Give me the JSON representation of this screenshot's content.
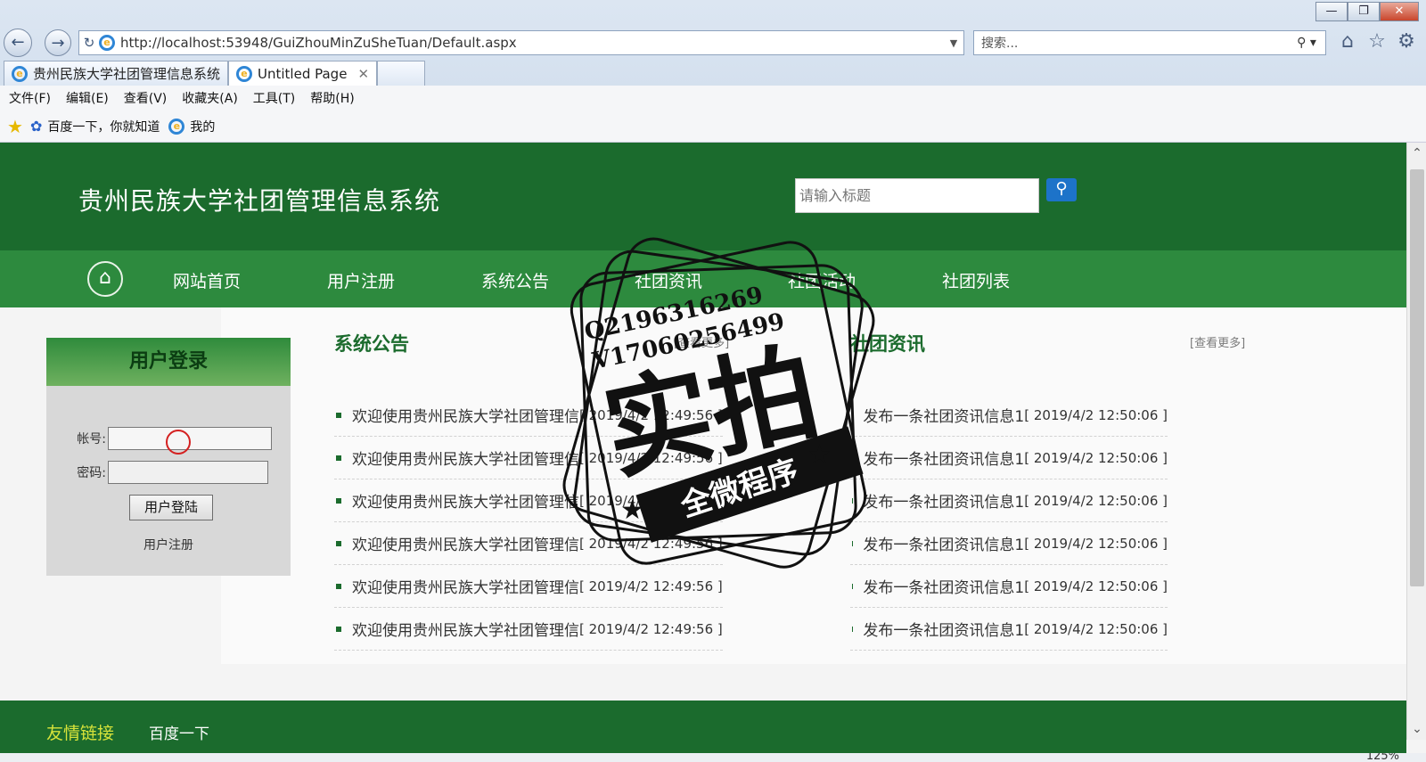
{
  "browser": {
    "url": "http://localhost:53948/GuiZhouMinZuSheTuan/Default.aspx",
    "search_placeholder": "搜索...",
    "tabs": [
      {
        "label": "贵州民族大学社团管理信息系统"
      },
      {
        "label": "Untitled Page"
      }
    ],
    "menu": [
      "文件(F)",
      "编辑(E)",
      "查看(V)",
      "收藏夹(A)",
      "工具(T)",
      "帮助(H)"
    ],
    "favorites": [
      "百度一下，你就知道",
      "我的"
    ],
    "zoom": "125%"
  },
  "site": {
    "title": "贵州民族大学社团管理信息系统",
    "search_placeholder": "请输入标题",
    "nav": [
      "网站首页",
      "用户注册",
      "系统公告",
      "社团资讯",
      "社团活动",
      "社团列表"
    ],
    "login": {
      "title": "用户登录",
      "account_label": "帐号:",
      "password_label": "密码:",
      "login_button": "用户登陆",
      "register_link": "用户注册"
    },
    "announcements": {
      "title": "系统公告",
      "more": "[查看更多]",
      "items": [
        {
          "title": "欢迎使用贵州民族大学社团管理信",
          "date": "[ 2019/4/2 12:49:56 ]"
        },
        {
          "title": "欢迎使用贵州民族大学社团管理信",
          "date": "[ 2019/4/2 12:49:56 ]"
        },
        {
          "title": "欢迎使用贵州民族大学社团管理信",
          "date": "[ 2019/4/2 12:49:56 ]"
        },
        {
          "title": "欢迎使用贵州民族大学社团管理信",
          "date": "[ 2019/4/2 12:49:56 ]"
        },
        {
          "title": "欢迎使用贵州民族大学社团管理信",
          "date": "[ 2019/4/2 12:49:56 ]"
        },
        {
          "title": "欢迎使用贵州民族大学社团管理信",
          "date": "[ 2019/4/2 12:49:56 ]"
        }
      ]
    },
    "news": {
      "title": "社团资讯",
      "more": "[查看更多]",
      "items": [
        {
          "title": "发布一条社团资讯信息1",
          "date": "[ 2019/4/2 12:50:06 ]"
        },
        {
          "title": "发布一条社团资讯信息1",
          "date": "[ 2019/4/2 12:50:06 ]"
        },
        {
          "title": "发布一条社团资讯信息1",
          "date": "[ 2019/4/2 12:50:06 ]"
        },
        {
          "title": "发布一条社团资讯信息1",
          "date": "[ 2019/4/2 12:50:06 ]"
        },
        {
          "title": "发布一条社团资讯信息1",
          "date": "[ 2019/4/2 12:50:06 ]"
        },
        {
          "title": "发布一条社团资讯信息1",
          "date": "[ 2019/4/2 12:50:06 ]"
        }
      ]
    },
    "footer": {
      "label": "友情链接",
      "link": "百度一下"
    }
  },
  "watermark": {
    "line1": "Q2196316269",
    "line2": "V17060256499",
    "main": "实拍",
    "banner": "全微程序"
  }
}
